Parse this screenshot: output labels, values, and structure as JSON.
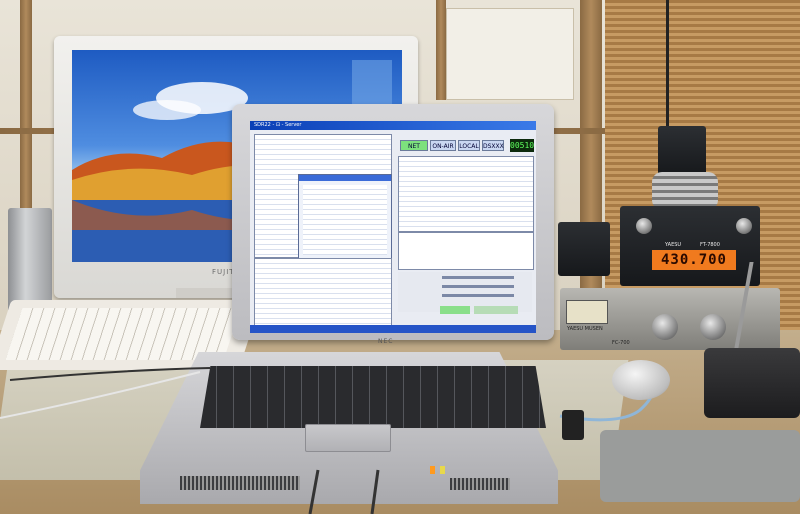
{
  "scene": {
    "monitor": {
      "brand_label": "FUJITSU"
    },
    "laptop": {
      "brand_label": "NEC",
      "app": {
        "title": "SDR22 - ⊡ - Server",
        "buttons": [
          "NET",
          "ON-AIR",
          "LOCAL",
          "DSXXX"
        ],
        "frequency_display": "00510"
      }
    },
    "transceiver": {
      "frequency_display": "430.700",
      "brand_label": "YAESU",
      "model_label": "FT-7800"
    },
    "power_supply": {
      "brand_label": "YAESU MUSEN",
      "model_label": "FC-700"
    }
  },
  "colors": {
    "sky": "#1e5bc2",
    "lcd_orange": "#f07a1e",
    "button_green": "#7de07d",
    "freq_green": "#5eff5e"
  }
}
